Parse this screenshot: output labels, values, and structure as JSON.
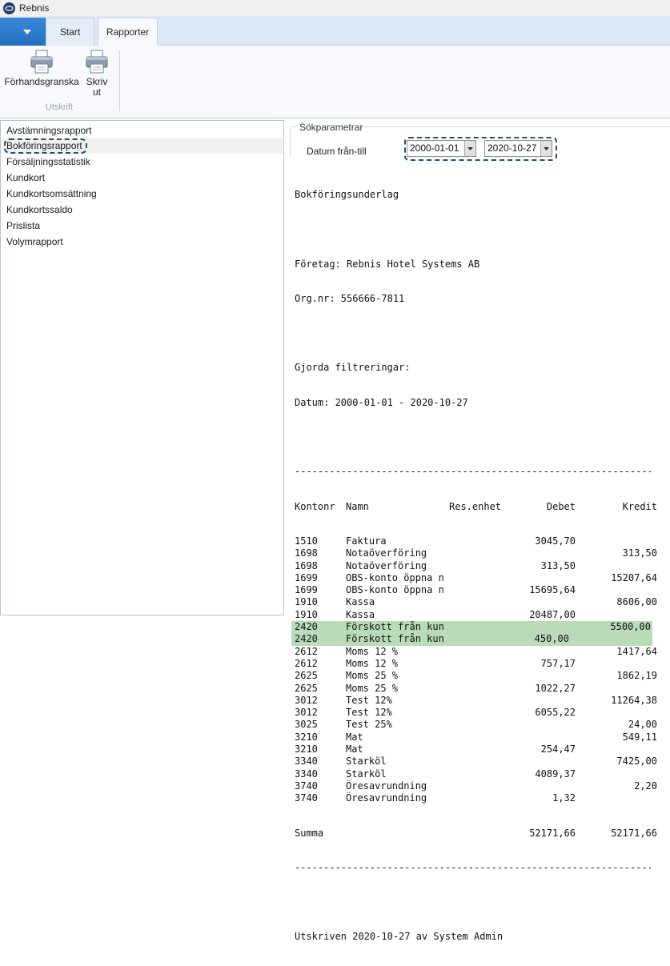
{
  "app": {
    "title": "Rebnis"
  },
  "tabs": {
    "start": "Start",
    "rapporter": "Rapporter"
  },
  "ribbon": {
    "preview_label": "Förhandsgranska",
    "print_label_line1": "Skriv",
    "print_label_line2": "ut",
    "group_label": "Utskrift"
  },
  "reports": [
    "Avstämningsrapport",
    "Bokföringsrapport",
    "Försäljningsstatistik",
    "Kundkort",
    "Kundkortsomsättning",
    "Kundkortssaldo",
    "Prislista",
    "Volymrapport"
  ],
  "selected_report": "Bokföringsrapport",
  "params": {
    "title": "Sökparametrar",
    "date_label": "Datum från-till",
    "date_from": "2000-01-01",
    "date_to": "2020-10-27"
  },
  "report": {
    "heading": "Bokföringsunderlag",
    "company_line": "Företag: Rebnis Hotel Systems AB",
    "orgnr_line": "Org.nr: 556666-7811",
    "filter_heading": "Gjorda filtreringar:",
    "filter_date_line": "Datum: 2000-01-01 - 2020-10-27",
    "separator": "--------------------------------------------------------------------------",
    "columns": {
      "kontonr": "Kontonr",
      "namn": "Namn",
      "resenhet": "Res.enhet",
      "debet": "Debet",
      "kredit": "Kredit"
    },
    "rows": [
      {
        "kontonr": "1510",
        "namn": "Faktura",
        "debet": "3045,70",
        "kredit": "",
        "highlight": false
      },
      {
        "kontonr": "1698",
        "namn": "Notaöverföring",
        "debet": "",
        "kredit": "313,50",
        "highlight": false
      },
      {
        "kontonr": "1698",
        "namn": "Notaöverföring",
        "debet": "313,50",
        "kredit": "",
        "highlight": false
      },
      {
        "kontonr": "1699",
        "namn": "OBS-konto öppna n",
        "debet": "",
        "kredit": "15207,64",
        "highlight": false
      },
      {
        "kontonr": "1699",
        "namn": "OBS-konto öppna n",
        "debet": "15695,64",
        "kredit": "",
        "highlight": false
      },
      {
        "kontonr": "1910",
        "namn": "Kassa",
        "debet": "",
        "kredit": "8606,00",
        "highlight": false
      },
      {
        "kontonr": "1910",
        "namn": "Kassa",
        "debet": "20487,00",
        "kredit": "",
        "highlight": false
      },
      {
        "kontonr": "2420",
        "namn": "Förskott från kun",
        "debet": "",
        "kredit": "5500,00",
        "highlight": true
      },
      {
        "kontonr": "2420",
        "namn": "Förskott från kun",
        "debet": "450,00",
        "kredit": "",
        "highlight": true
      },
      {
        "kontonr": "2612",
        "namn": "Moms 12 %",
        "debet": "",
        "kredit": "1417,64",
        "highlight": false
      },
      {
        "kontonr": "2612",
        "namn": "Moms 12 %",
        "debet": "757,17",
        "kredit": "",
        "highlight": false
      },
      {
        "kontonr": "2625",
        "namn": "Moms 25 %",
        "debet": "",
        "kredit": "1862,19",
        "highlight": false
      },
      {
        "kontonr": "2625",
        "namn": "Moms 25 %",
        "debet": "1022,27",
        "kredit": "",
        "highlight": false
      },
      {
        "kontonr": "3012",
        "namn": "Test 12%",
        "debet": "",
        "kredit": "11264,38",
        "highlight": false
      },
      {
        "kontonr": "3012",
        "namn": "Test 12%",
        "debet": "6055,22",
        "kredit": "",
        "highlight": false
      },
      {
        "kontonr": "3025",
        "namn": "Test 25%",
        "debet": "",
        "kredit": "24,00",
        "highlight": false
      },
      {
        "kontonr": "3210",
        "namn": "Mat",
        "debet": "",
        "kredit": "549,11",
        "highlight": false
      },
      {
        "kontonr": "3210",
        "namn": "Mat",
        "debet": "254,47",
        "kredit": "",
        "highlight": false
      },
      {
        "kontonr": "3340",
        "namn": "Starköl",
        "debet": "",
        "kredit": "7425,00",
        "highlight": false
      },
      {
        "kontonr": "3340",
        "namn": "Starköl",
        "debet": "4089,37",
        "kredit": "",
        "highlight": false
      },
      {
        "kontonr": "3740",
        "namn": "Öresavrundning",
        "debet": "",
        "kredit": "2,20",
        "highlight": false
      },
      {
        "kontonr": "3740",
        "namn": "Öresavrundning",
        "debet": "1,32",
        "kredit": "",
        "highlight": false
      }
    ],
    "summa": {
      "label": "Summa",
      "debet": "52171,66",
      "kredit": "52171,66"
    },
    "footer": "Utskriven 2020-10-27 av System Admin"
  }
}
